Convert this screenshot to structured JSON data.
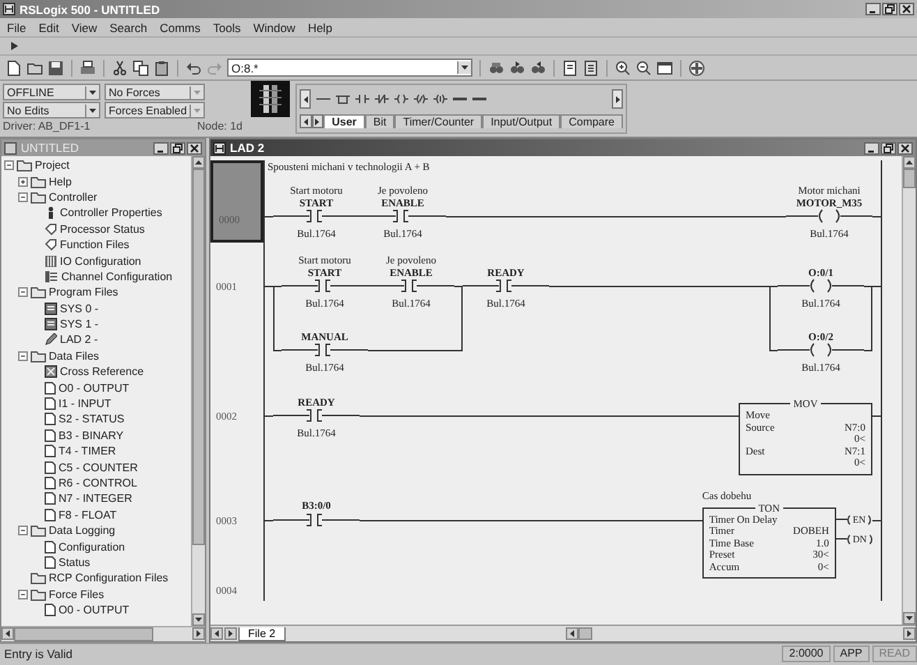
{
  "window": {
    "title": "RSLogix 500 - UNTITLED"
  },
  "menu": [
    "File",
    "Edit",
    "View",
    "Search",
    "Comms",
    "Tools",
    "Window",
    "Help"
  ],
  "toolbar": {
    "address": "O:8.*"
  },
  "status": {
    "mode": "OFFLINE",
    "forces": "No Forces",
    "edits": "No Edits",
    "forces_enabled": "Forces Enabled",
    "driver": "Driver: AB_DF1-1",
    "node": "Node: 1d"
  },
  "palette_tabs": [
    {
      "label": "User",
      "selected": true
    },
    {
      "label": "Bit",
      "selected": false
    },
    {
      "label": "Timer/Counter",
      "selected": false
    },
    {
      "label": "Input/Output",
      "selected": false
    },
    {
      "label": "Compare",
      "selected": false
    }
  ],
  "project_window": {
    "title": "UNTITLED",
    "tree": [
      {
        "label": "Project",
        "kind": "folder",
        "expanded": true,
        "children": [
          {
            "label": "Help",
            "kind": "folder",
            "expanded": false
          },
          {
            "label": "Controller",
            "kind": "folder",
            "expanded": true,
            "children": [
              {
                "label": "Controller Properties",
                "kind": "properties"
              },
              {
                "label": "Processor Status",
                "kind": "status"
              },
              {
                "label": "Function Files",
                "kind": "status"
              },
              {
                "label": "IO Configuration",
                "kind": "io"
              },
              {
                "label": "Channel Configuration",
                "kind": "channel"
              }
            ]
          },
          {
            "label": "Program Files",
            "kind": "folder",
            "expanded": true,
            "children": [
              {
                "label": "SYS 0 -",
                "kind": "program"
              },
              {
                "label": "SYS 1 -",
                "kind": "program"
              },
              {
                "label": "LAD 2 -",
                "kind": "ladder"
              }
            ]
          },
          {
            "label": "Data Files",
            "kind": "folder",
            "expanded": true,
            "children": [
              {
                "label": "Cross Reference",
                "kind": "crossref"
              },
              {
                "label": "O0 - OUTPUT",
                "kind": "file"
              },
              {
                "label": "I1 - INPUT",
                "kind": "file"
              },
              {
                "label": "S2 - STATUS",
                "kind": "file"
              },
              {
                "label": "B3 - BINARY",
                "kind": "file"
              },
              {
                "label": "T4 - TIMER",
                "kind": "file"
              },
              {
                "label": "C5 - COUNTER",
                "kind": "file"
              },
              {
                "label": "R6 - CONTROL",
                "kind": "file"
              },
              {
                "label": "N7 - INTEGER",
                "kind": "file"
              },
              {
                "label": "F8 - FLOAT",
                "kind": "file"
              }
            ]
          },
          {
            "label": "Data Logging",
            "kind": "folder",
            "expanded": true,
            "children": [
              {
                "label": "Configuration",
                "kind": "file"
              },
              {
                "label": "Status",
                "kind": "file"
              }
            ]
          },
          {
            "label": "RCP Configuration Files",
            "kind": "folder"
          },
          {
            "label": "Force Files",
            "kind": "folder",
            "expanded": true,
            "children": [
              {
                "label": "O0 - OUTPUT",
                "kind": "file"
              }
            ]
          }
        ]
      }
    ]
  },
  "ladder_window": {
    "title": "LAD 2",
    "file_tab": "File 2",
    "rungs": [
      {
        "number": "0000",
        "selected": true,
        "comment": "Spousteni michani v technologii A + B",
        "inputs": [
          {
            "kind": "contact",
            "description": "Start motoru",
            "tag": "START",
            "address": "Bul.1764"
          },
          {
            "kind": "contact",
            "description": "Je povoleno",
            "tag": "ENABLE",
            "address": "Bul.1764"
          }
        ],
        "outputs": [
          {
            "kind": "coil",
            "description": "Motor michani",
            "tag": "MOTOR_M35",
            "address": "Bul.1764"
          }
        ]
      },
      {
        "number": "0001",
        "selected": false,
        "inputs": [
          {
            "kind": "branch",
            "rows": [
              [
                {
                  "kind": "contact",
                  "description": "Start motoru",
                  "tag": "START",
                  "address": "Bul.1764"
                },
                {
                  "kind": "contact",
                  "description": "Je povoleno",
                  "tag": "ENABLE",
                  "address": "Bul.1764"
                }
              ],
              [
                {
                  "kind": "contact",
                  "tag": "MANUAL",
                  "address": "Bul.1764"
                }
              ]
            ]
          },
          {
            "kind": "contact",
            "tag": "READY",
            "address": "Bul.1764"
          }
        ],
        "outputs": [
          {
            "kind": "branch",
            "rows": [
              [
                {
                  "kind": "coil",
                  "tag": "O:0/1",
                  "address": "Bul.1764"
                }
              ],
              [
                {
                  "kind": "coil",
                  "tag": "O:0/2",
                  "address": "Bul.1764"
                }
              ]
            ]
          }
        ]
      },
      {
        "number": "0002",
        "selected": false,
        "inputs": [
          {
            "kind": "contact",
            "tag": "READY",
            "address": "Bul.1764"
          }
        ],
        "outputs": [
          {
            "kind": "box",
            "title": "MOV",
            "rows": [
              {
                "label": "Move"
              },
              {
                "label": "Source",
                "value": "N7:0",
                "sub": "0<"
              },
              {
                "label": "Dest",
                "value": "N7:1",
                "sub": "0<"
              }
            ]
          }
        ]
      },
      {
        "number": "0003",
        "selected": false,
        "inputs": [
          {
            "kind": "contact",
            "tag": "B3:0/0"
          }
        ],
        "outputs": [
          {
            "kind": "box",
            "title": "TON",
            "comment": "Cas dobehu",
            "rows": [
              {
                "label": "Timer On Delay"
              },
              {
                "label": "Timer",
                "value": "DOBEH"
              },
              {
                "label": "Time Base",
                "value": "1.0"
              },
              {
                "label": "Preset",
                "value": "30<"
              },
              {
                "label": "Accum",
                "value": "0<"
              }
            ],
            "coils": [
              "EN",
              "DN"
            ]
          }
        ]
      },
      {
        "number": "0004",
        "selected": false
      }
    ]
  },
  "status_bar": {
    "message": "Entry is Valid",
    "panels": [
      {
        "text": "2:0000",
        "disabled": false
      },
      {
        "text": "APP",
        "disabled": false
      },
      {
        "text": "READ",
        "disabled": true
      }
    ]
  }
}
